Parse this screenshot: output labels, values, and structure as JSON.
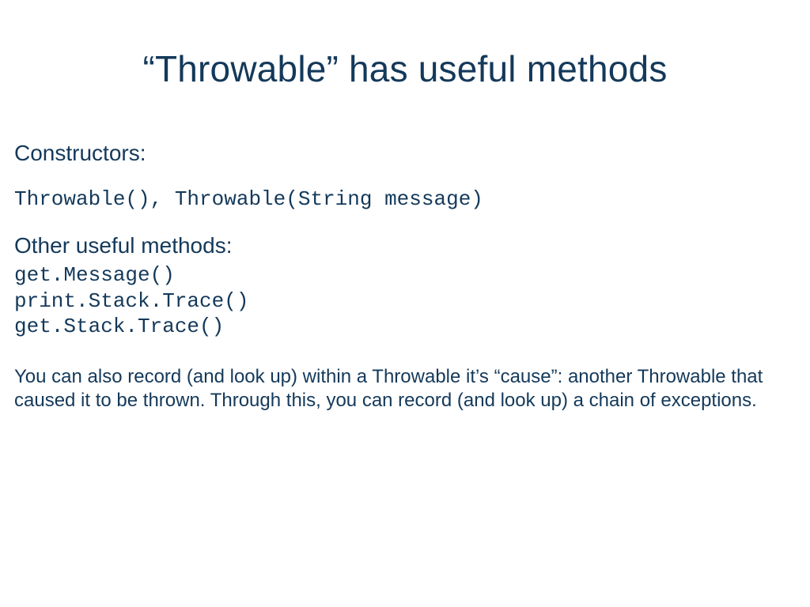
{
  "title": "“Throwable” has useful methods",
  "constructors": {
    "heading": "Constructors:",
    "code": "Throwable(), Throwable(String message)"
  },
  "methods": {
    "heading": "Other useful methods:",
    "code": "get.Message()\nprint.Stack.Trace()\nget.Stack.Trace()"
  },
  "paragraph": "You can also record (and look up) within a Throwable it’s “cause”: another Throwable that caused it to be thrown.  Through this, you can record (and look up) a chain of exceptions."
}
